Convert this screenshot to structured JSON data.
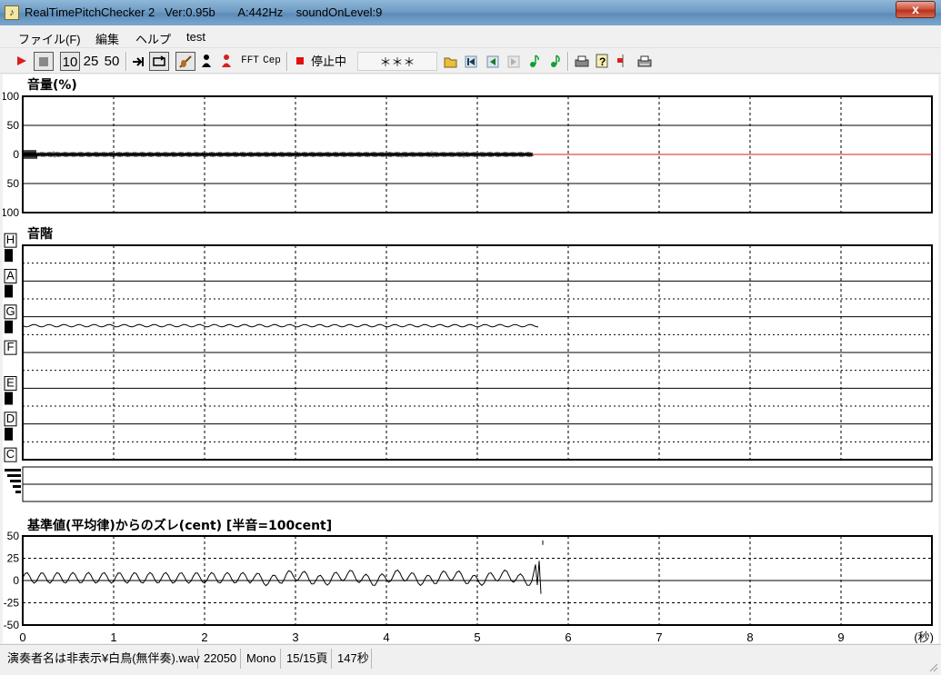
{
  "window": {
    "title": "RealTimePitchChecker 2   Ver:0.95b       A:442Hz    soundOnLevel:9",
    "close_label": "x"
  },
  "menu": [
    "ファイル(F)",
    "編集",
    "ヘルプ",
    "test"
  ],
  "toolbar": {
    "zoom_10": "10",
    "zoom_25": "25",
    "zoom_50": "50",
    "fft_label": "FFT",
    "cep_label": "Cep",
    "status_text": "停止中",
    "placeholder_text": "＊＊＊"
  },
  "volume_panel": {
    "title": "音量(%)",
    "y_ticks": [
      "100",
      "50",
      "0",
      "50",
      "100"
    ]
  },
  "scale_panel": {
    "title": "音階",
    "notes": [
      "H",
      "A",
      "G",
      "F",
      "E",
      "D",
      "C"
    ]
  },
  "cent_panel": {
    "title": "基準値(平均律)からのズレ(cent) [半音=100cent]",
    "y_ticks": [
      "50",
      "25",
      "0",
      "-25",
      "-50"
    ]
  },
  "time_axis": {
    "ticks": [
      "0",
      "1",
      "2",
      "3",
      "4",
      "5",
      "6",
      "7",
      "8",
      "9"
    ],
    "unit": "(秒)"
  },
  "statusbar": {
    "file": "演奏者名は非表示¥白鳥(無伴奏).wav",
    "rate": "22050",
    "channels": "Mono",
    "page": "15/15頁",
    "length": "147秒"
  },
  "colors": {
    "grid": "#000000",
    "trace": "#000000",
    "zero_line_after": "#d02020"
  },
  "chart_data": [
    {
      "type": "line",
      "title": "音量(%)",
      "xlabel": "(秒)",
      "ylim": [
        -100,
        100
      ],
      "xlim": [
        0,
        10
      ],
      "description_series": "volume envelope near 0, signal from 0 to about 5.6 s"
    },
    {
      "type": "line",
      "title": "音階",
      "xlim": [
        0,
        10
      ],
      "y_notes": [
        "C",
        "D",
        "E",
        "F",
        "G",
        "A",
        "H"
      ],
      "pitch_near": "G",
      "x_end": 5.7
    },
    {
      "type": "line",
      "title": "基準値(平均律)からのズレ(cent) [半音=100cent]",
      "xlabel": "(秒)",
      "ylim": [
        -50,
        50
      ],
      "xlim": [
        0,
        10
      ],
      "x_end": 5.7,
      "approx_range": [
        -15,
        25
      ]
    }
  ]
}
